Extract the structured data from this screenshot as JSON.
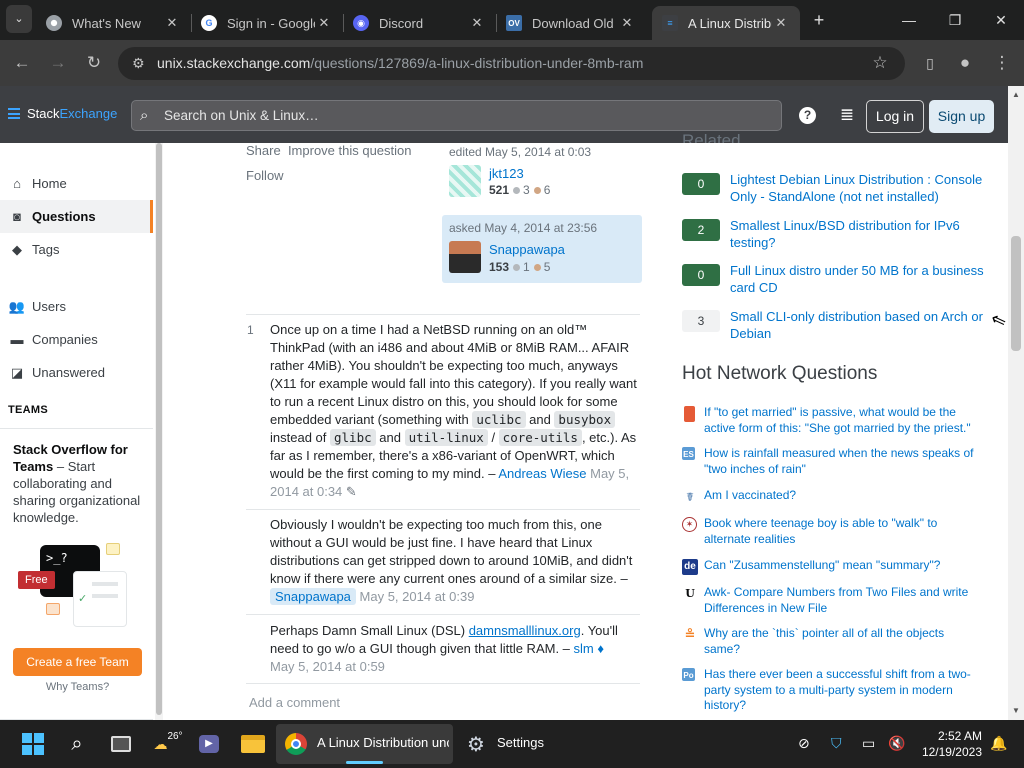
{
  "browser": {
    "tabs": [
      {
        "title": "What's New",
        "icon": "chrome-icon"
      },
      {
        "title": "Sign in - Google",
        "icon": "google-icon"
      },
      {
        "title": "Discord",
        "icon": "discord-icon"
      },
      {
        "title": "Download Old",
        "icon": "oldversion-icon"
      },
      {
        "title": "A Linux Distribu",
        "icon": "stackexchange-icon"
      }
    ],
    "url_host": "unix.stackexchange.com",
    "url_path": "/questions/127869/a-linux-distribution-under-8mb-ram"
  },
  "header": {
    "logo_a": "Stack",
    "logo_b": "Exchange",
    "search_placeholder": "Search on Unix & Linux…",
    "login": "Log in",
    "signup": "Sign up"
  },
  "nav": {
    "items": [
      "Home",
      "Questions",
      "Tags",
      "Users",
      "Companies",
      "Unanswered"
    ],
    "teams_label": "TEAMS",
    "teams_title": "Stack Overflow for Teams",
    "teams_text": " – Start collaborating and sharing organizational knowledge.",
    "free_badge": "Free",
    "create_team": "Create a free Team",
    "why_teams": "Why Teams?"
  },
  "post": {
    "share": "Share",
    "improve": "Improve this question",
    "follow": "Follow",
    "edited": "edited May 5, 2014 at 0:03",
    "editor": "jkt123",
    "editor_rep": "521",
    "editor_silver": "3",
    "editor_bronze": "6",
    "asked": "asked May 4, 2014 at 23:56",
    "asker": "Snappawapa",
    "asker_rep": "153",
    "asker_silver": "1",
    "asker_bronze": "5"
  },
  "comments": [
    {
      "score": "1",
      "text_a": "Once up on a time I had a NetBSD running on an old™ ThinkPad (with an i486 and about 4MiB or 8MiB RAM... AFAIR rather 4MiB). You shouldn't be expecting too much, anyways (X11 for example would fall into this category). If you really want to run a recent Linux distro on this, you should look for some embedded variant (something with ",
      "code1": "uclibc",
      "and1": " and ",
      "code2": "busybox",
      "insteadof": " instead of ",
      "code3": "glibc",
      "and2": " and ",
      "code4": "util-linux",
      "slash": " / ",
      "code5": "core-utils",
      "text_b": ", etc.). As far as I remember, there's a x86-variant of OpenWRT, which would be the first coming to my mind.",
      "author": "Andreas Wiese",
      "time": "May 5, 2014 at 0:34"
    },
    {
      "text": "Obviously I wouldn't be expecting too much from this, one without a GUI would be just fine. I have heard that Linux distributions can get stripped down to around 10MiB, and didn't know if there were any current ones around of a similar size.",
      "author": "Snappawapa",
      "time": "May 5, 2014 at 0:39"
    },
    {
      "text_a": "Perhaps Damn Small Linux (DSL) ",
      "link": "damnsmalllinux.org",
      "text_b": ". You'll need to go w/o a GUI though given that little RAM.",
      "author": "slm",
      "time": "May 5, 2014 at 0:59"
    }
  ],
  "add_comment": "Add a comment",
  "related": {
    "heading": "Related",
    "items": [
      {
        "votes": "0",
        "title": "Lightest Debian Linux Distribution : Console Only - StandAlone (not net installed)",
        "answered": true
      },
      {
        "votes": "2",
        "title": "Smallest Linux/BSD distribution for IPv6 testing?",
        "answered": true
      },
      {
        "votes": "0",
        "title": "Full Linux distro under 50 MB for a business card CD",
        "answered": true
      },
      {
        "votes": "3",
        "title": "Small CLI-only distribution based on Arch or Debian",
        "answered": false
      }
    ]
  },
  "hot": {
    "heading": "Hot Network Questions",
    "items": [
      {
        "title": "If \"to get married\" is passive, what would be the active form of this: \"She got married by the priest.\"",
        "site": "english-icon"
      },
      {
        "title": "How is rainfall measured when the news speaks of \"two inches of rain\"",
        "site": "earthscience-icon"
      },
      {
        "title": "Am I vaccinated?",
        "site": "medicalsciences-icon"
      },
      {
        "title": "Book where teenage boy is able to \"walk\" to alternate realities",
        "site": "scifi-icon"
      },
      {
        "title": "Can \"Zusammenstellung\" mean \"summary\"?",
        "site": "german-icon"
      },
      {
        "title": "Awk- Compare Numbers from Two Files and write Differences in New File",
        "site": "unix-icon"
      },
      {
        "title": "Why are the `this` pointer all of all the objects same?",
        "site": "stackoverflow-icon"
      },
      {
        "title": "Has there ever been a successful shift from a two-party system to a multi-party system in modern history?",
        "site": "politics-icon"
      }
    ]
  },
  "taskbar": {
    "weather": "26°",
    "chrome_label": "A Linux Distribution unc",
    "settings_label": "Settings",
    "time": "2:52 AM",
    "date": "12/19/2023"
  },
  "colors": {
    "accent": "#f48225",
    "link": "#0074cc",
    "answered": "#2f6f44",
    "se_blue": "#3ca4ff"
  }
}
